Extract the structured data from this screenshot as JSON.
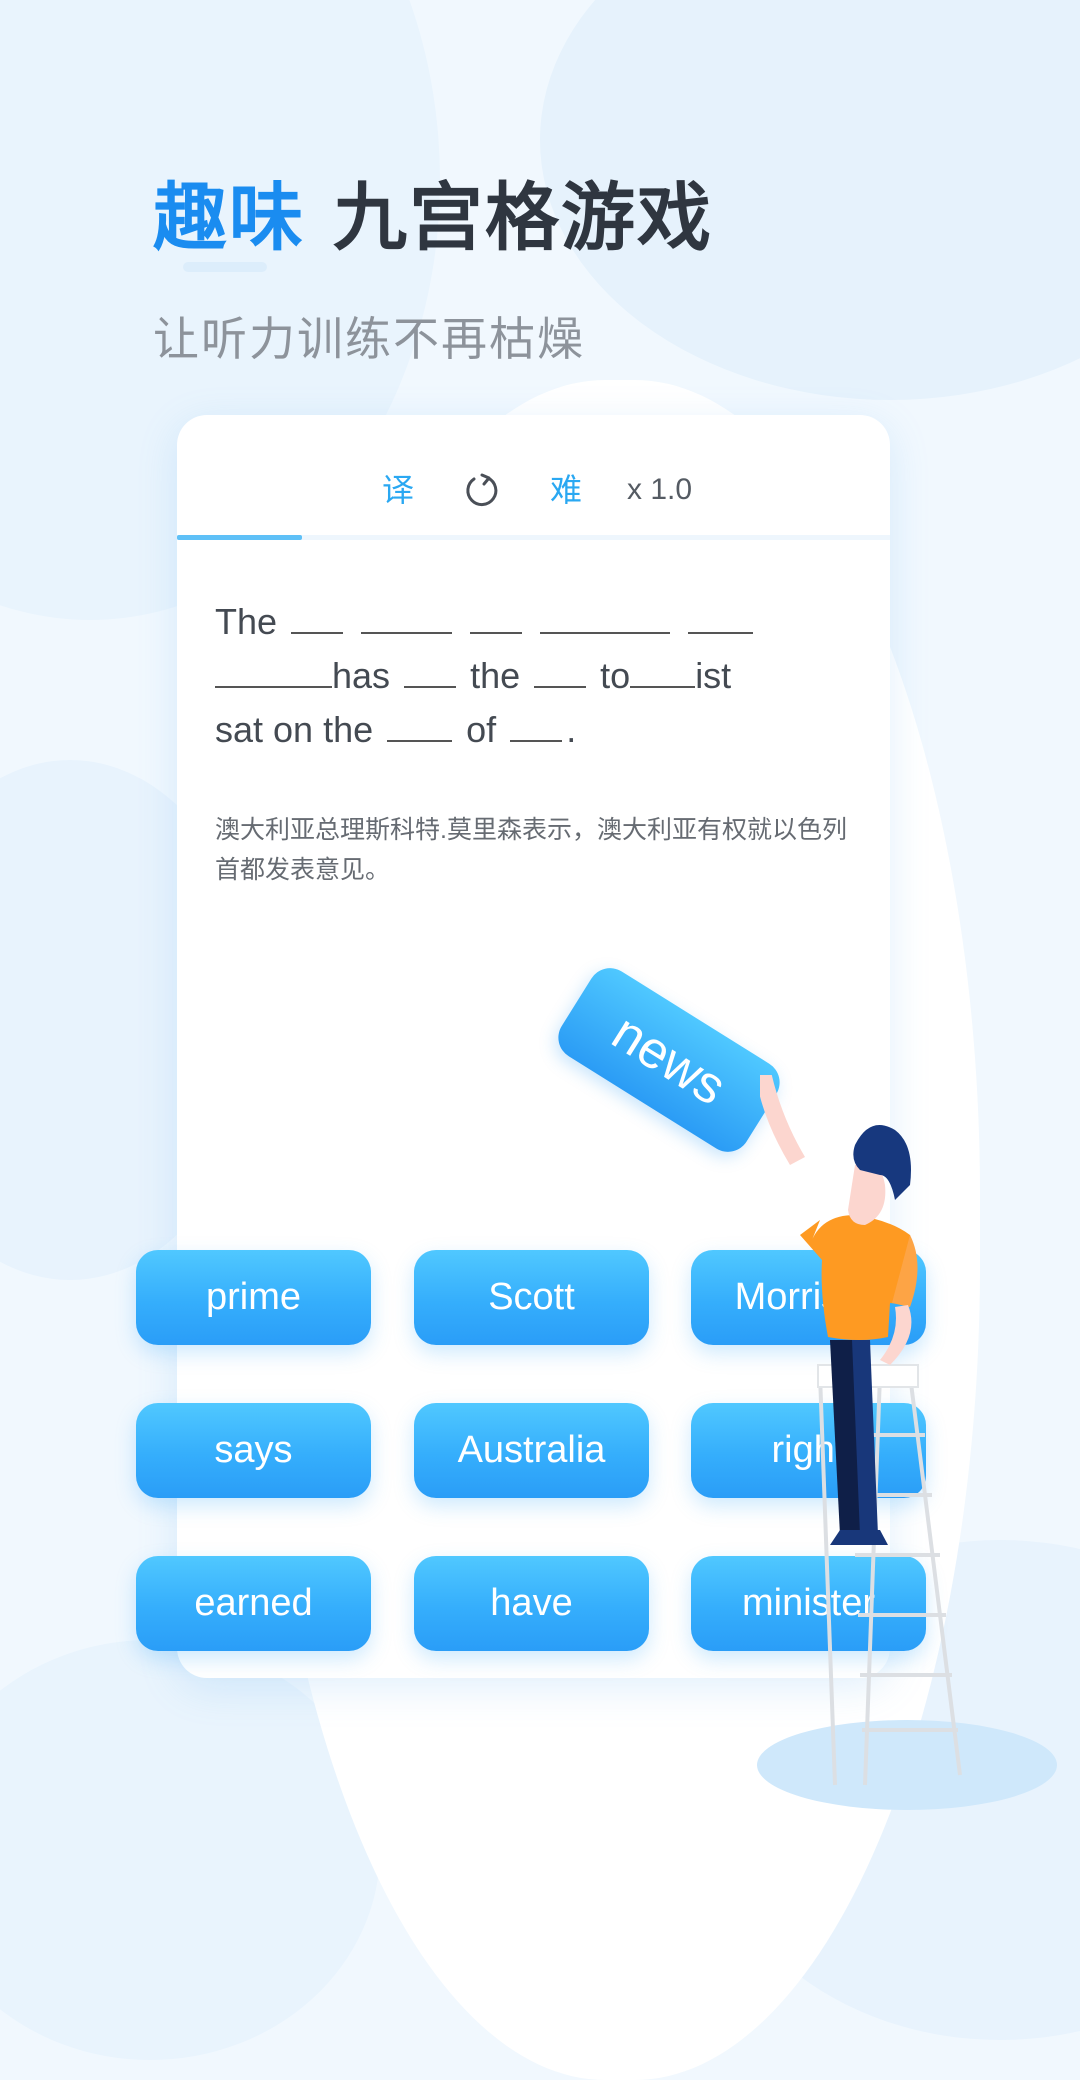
{
  "header": {
    "title_accent": "趣味",
    "title_main": "九宫格游戏",
    "subtitle": "让听力训练不再枯燥"
  },
  "toolbar": {
    "translate_label": "译",
    "refresh_icon": "refresh-icon",
    "difficulty_label": "难",
    "speed_label": "x 1.0"
  },
  "progress": {
    "fraction": 0.175
  },
  "sentence": {
    "lines": [
      [
        {
          "t": "The"
        },
        {
          "b": 4
        },
        {
          "b": 7
        },
        {
          "b": 4
        },
        {
          "b": 10
        },
        {
          "b": 5
        }
      ],
      [
        {
          "b": 9,
          "tight": true
        },
        {
          "t": "has"
        },
        {
          "b": 4
        },
        {
          "t": "the"
        },
        {
          "b": 4
        },
        {
          "t": "to"
        },
        {
          "b": 5,
          "tight": true
        },
        {
          "t": "ist"
        }
      ],
      [
        {
          "t": "sat on the"
        },
        {
          "b": 5
        },
        {
          "t": "of"
        },
        {
          "b": 4
        },
        {
          "t": "."
        }
      ]
    ]
  },
  "translation": "澳大利亚总理斯科特.莫里森表示，澳大利亚有权就以色列首都发表意见。",
  "dragged_word": "news",
  "words": [
    "prime",
    "Scott",
    "Morrison",
    "says",
    "Australia",
    "right",
    "earned",
    "have",
    "minister"
  ],
  "colors": {
    "accent": "#1a8cf0",
    "button_top": "#50c8ff",
    "button_bottom": "#2a9df7",
    "progress": "#5ec0f7"
  }
}
